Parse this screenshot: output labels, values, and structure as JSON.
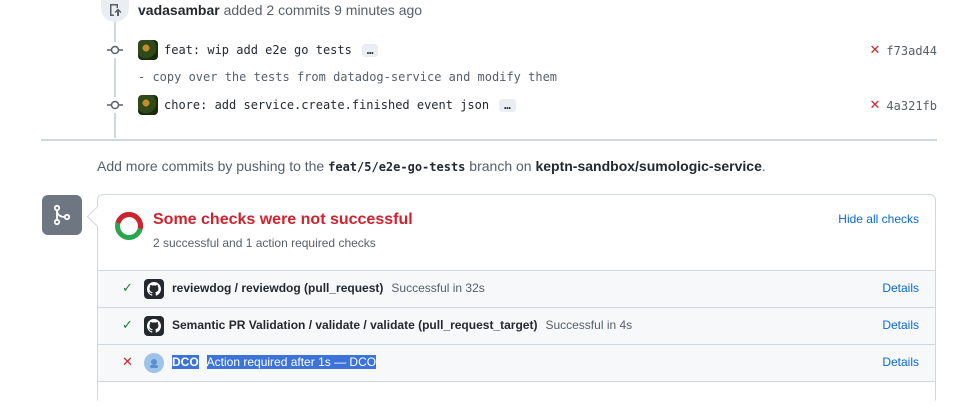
{
  "timeline": {
    "push_user": "vadasambar",
    "push_action": "added 2 commits 9 minutes ago",
    "commits": [
      {
        "message": "feat: wip add e2e go tests",
        "status": "failure",
        "sha": "f73ad44",
        "description": "- copy over the tests from datadog-service and modify them"
      },
      {
        "message": "chore: add service.create.finished event json",
        "status": "failure",
        "sha": "4a321fb"
      }
    ],
    "ellipsis": "…"
  },
  "push_note": {
    "prefix": "Add more commits by pushing to the",
    "branch": "feat/5/e2e-go-tests",
    "middle": "branch on",
    "repo": "keptn-sandbox/sumologic-service",
    "suffix": "."
  },
  "checks": {
    "title": "Some checks were not successful",
    "subtitle": "2 successful and 1 action required checks",
    "hide_label": "Hide all checks",
    "colors": {
      "success": "#1a7f37",
      "failure": "#cf222e",
      "link": "#0969da"
    },
    "items": [
      {
        "name": "reviewdog / reviewdog (pull_request)",
        "status": "success",
        "description": "Successful in 32s",
        "details": "Details"
      },
      {
        "name": "Semantic PR Validation / validate / validate (pull_request_target)",
        "status": "success",
        "description": "Successful in 4s",
        "details": "Details"
      },
      {
        "name": "DCO",
        "status": "failure",
        "description": "Action required after 1s — DCO",
        "details": "Details"
      }
    ]
  }
}
